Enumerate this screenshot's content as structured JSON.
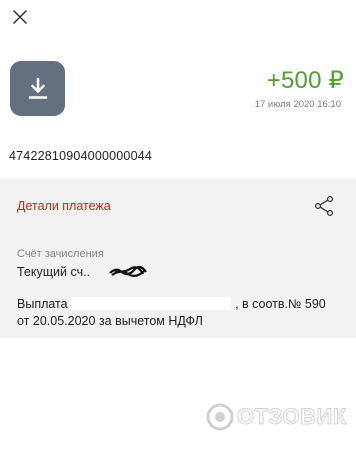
{
  "header": {
    "close_icon": "close-icon"
  },
  "transaction": {
    "icon": "download-icon",
    "amount": "+500 ₽",
    "datetime": "17 июля 2020 16:10",
    "account_number": "47422810904000000044",
    "amount_color": "#53a032"
  },
  "details": {
    "title": "Детали платежа",
    "title_color": "#b52b1c",
    "share_icon": "share-icon",
    "credit_account_label": "Счёт зачисления",
    "credit_account_value": "Текущий сч..",
    "description_prefix": "Выплата",
    "description_suffix": ", в соотв.№ 590 от 20.05.2020 за вычетом НДФЛ"
  },
  "watermark": {
    "text": "ОТЗОВИК"
  }
}
